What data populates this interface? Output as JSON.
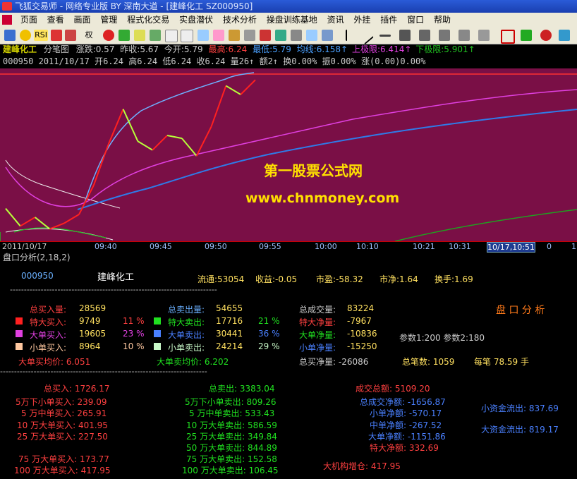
{
  "window": {
    "title": "飞狐交易师 - 网络专业版 BY 深南大道 - [建峰化工 SZ000950]"
  },
  "menu": [
    "页面",
    "查看",
    "画面",
    "管理",
    "程式化交易",
    "实盘潜伏",
    "技术分析",
    "操盘训练基地",
    "资讯",
    "外挂",
    "插件",
    "窗口",
    "帮助"
  ],
  "toolbar": {
    "rsi": "RSI",
    "quan": "权"
  },
  "quote": {
    "name": "建峰化工",
    "view": "分笔图",
    "zhangdie": "涨跌:0.57",
    "zuoshou": "昨收:5.67",
    "jinkai": "今开:5.79",
    "zuigao": "最高:6.24",
    "zuidi": "最低:5.79",
    "junxian": "均线:6.158↑",
    "shangjixian": "上极限:6.414↑",
    "xiajixian": "下极限:5.901↑"
  },
  "bar": {
    "code": "000950",
    "date": "2011/10/17",
    "kai": "开6.24",
    "gao": "高6.24",
    "di": "低6.24",
    "shou": "收6.24",
    "liang": "量26↑",
    "e": "额2↑",
    "huan": "换0.00%",
    "zhen": "振0.00%",
    "zhang": "涨(0.00)0.00%"
  },
  "watermark": {
    "cn": "第一股票公式网",
    "url": "www.chnmoney.com"
  },
  "timeaxis": {
    "date": "2011/10/17",
    "t940": "09:40",
    "t945": "09:45",
    "t950": "09:50",
    "t955": "09:55",
    "t1000": "10:00",
    "t1010": "10:10",
    "t1021": "10:21",
    "t1031": "10:31",
    "cursor": "10/17,10:51",
    "t0": "0",
    "t1": "1"
  },
  "panel": {
    "title": "盘口分析(2,18,2)",
    "code": "000950",
    "name": "建峰化工",
    "liutong": "流通:53054",
    "shouyi": "收益:-0.05",
    "shiying": "市盈:-58.32",
    "shijing": "市净:1.64",
    "huanshou": "换手:1.69",
    "buyin_label": "总买入量:",
    "buyin_val": "28569",
    "sellout_label": "总卖出量:",
    "sellout_val": "54655",
    "vol_label": "总成交量:",
    "vol_val": "83224",
    "hdr": "盘 口 分 析",
    "r1_l": "特大买入:",
    "r1_v": "9749",
    "r1_p": "11 %",
    "r1s_l": "特大卖出:",
    "r1s_v": "17716",
    "r1s_p": "21 %",
    "r1n_l": "特大净量:",
    "r1n_v": "-7967",
    "r2_l": "大单买入:",
    "r2_v": "19605",
    "r2_p": "23 %",
    "r2s_l": "大单卖出:",
    "r2s_v": "30441",
    "r2s_p": "36 %",
    "r2n_l": "大单净量:",
    "r2n_v": "-10836",
    "param": "参数1:200  参数2:180",
    "r3_l": "小单买入:",
    "r3_v": "8964",
    "r3_p": "10 %",
    "r3s_l": "小单卖出:",
    "r3s_v": "24214",
    "r3s_p": "29 %",
    "r3n_l": "小单净量:",
    "r3n_v": "-15250",
    "avgbuy": "大单买均价: 6.051",
    "avgsell": "大单卖均价: 6.202",
    "netbuy": "总买净量: -26086",
    "bishu": "总笔数: 1059",
    "meibi": "每笔  78.59 手",
    "dashes": "--------------------------------------------------------------------------",
    "tbuy": "总买入: 1726.17",
    "tsell": "总卖出: 3383.04",
    "tamount": "成交总额: 5109.20",
    "b1": "5万下小单买入: 239.09",
    "s1": "5万下小单卖出: 809.26",
    "n1": "总成交净额: -1656.87",
    "b2": "5 万中单买入: 265.91",
    "s2": "5 万中单卖出: 533.43",
    "n2": "小单净额: -570.17",
    "xzj": "小资金流出: 837.69",
    "b3": "10 万大单买入: 401.95",
    "s3": "10 万大单卖出: 586.59",
    "n3": "中单净额: -267.52",
    "dzj": "大资金流出: 819.17",
    "b4": "25 万大单买入: 227.50",
    "s4": "25 万大单卖出: 349.84",
    "n4": "大单净额: -1151.86",
    "s5": "50 万大单卖出: 844.89",
    "n5": "特大净额: 332.69",
    "b6": "75 万大单买入: 173.77",
    "s6": "75 万大单卖出: 152.58",
    "b7": "100 万大单买入: 417.95",
    "s7": "100 万大单卖出: 106.45",
    "inst": "大机构增仓: 417.95"
  },
  "chart_data": {
    "type": "line",
    "title": "",
    "xlabel": "",
    "ylabel": "",
    "x_ticks": [
      "09:40",
      "09:45",
      "09:50",
      "09:55",
      "10:00",
      "10:10",
      "10:21",
      "10:31",
      "10/17,10:51"
    ],
    "series": [
      {
        "name": "",
        "values": [
          5.8,
          5.74,
          5.77,
          5.73,
          5.75,
          5.78,
          5.88,
          6.02,
          6.14,
          6.03,
          6.0,
          6.05,
          6.04,
          5.98,
          6.08,
          6.22,
          6.19,
          6.24
        ]
      }
    ]
  },
  "colors": {
    "chart_bg": "#7a0f46",
    "price_up": "#ff2020",
    "price_dn": "#b8ff3a",
    "ma_blue": "#2f7be8",
    "ma_light": "#6eb0ff",
    "magenta": "#e040e0"
  }
}
